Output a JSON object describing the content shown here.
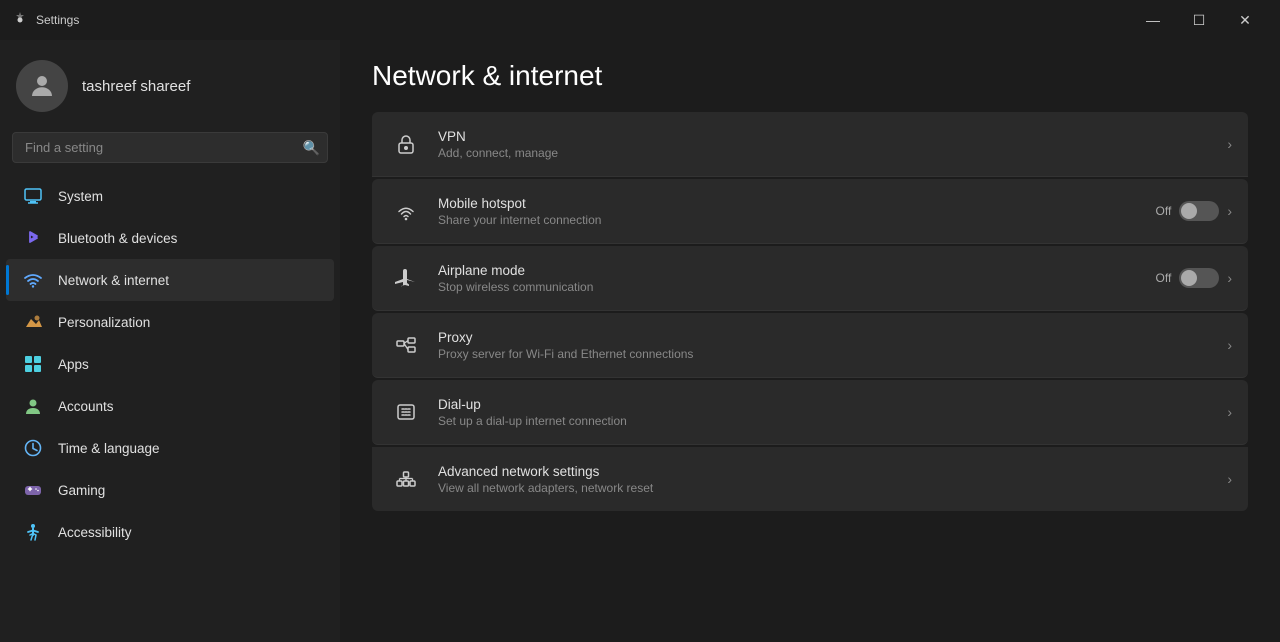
{
  "titlebar": {
    "title": "Settings",
    "controls": {
      "minimize": "—",
      "maximize": "☐",
      "close": "✕"
    }
  },
  "sidebar": {
    "profile": {
      "name": "tashreef shareef"
    },
    "search": {
      "placeholder": "Find a setting"
    },
    "nav": [
      {
        "id": "system",
        "label": "System",
        "icon": "🖥",
        "active": false
      },
      {
        "id": "bluetooth",
        "label": "Bluetooth & devices",
        "icon": "⬡",
        "active": false
      },
      {
        "id": "network",
        "label": "Network & internet",
        "icon": "🌐",
        "active": true
      },
      {
        "id": "personalization",
        "label": "Personalization",
        "icon": "✏",
        "active": false
      },
      {
        "id": "apps",
        "label": "Apps",
        "icon": "⊞",
        "active": false
      },
      {
        "id": "accounts",
        "label": "Accounts",
        "icon": "👤",
        "active": false
      },
      {
        "id": "time",
        "label": "Time & language",
        "icon": "🕐",
        "active": false
      },
      {
        "id": "gaming",
        "label": "Gaming",
        "icon": "🎮",
        "active": false
      },
      {
        "id": "accessibility",
        "label": "Accessibility",
        "icon": "♿",
        "active": false
      }
    ]
  },
  "content": {
    "page_title": "Network & internet",
    "items": [
      {
        "id": "vpn",
        "title": "VPN",
        "subtitle": "Add, connect, manage",
        "icon": "🔒",
        "has_toggle": false,
        "toggle_label": "",
        "has_chevron": true
      },
      {
        "id": "mobile-hotspot",
        "title": "Mobile hotspot",
        "subtitle": "Share your internet connection",
        "icon": "📶",
        "has_toggle": true,
        "toggle_label": "Off",
        "has_chevron": true
      },
      {
        "id": "airplane-mode",
        "title": "Airplane mode",
        "subtitle": "Stop wireless communication",
        "icon": "✈",
        "has_toggle": true,
        "toggle_label": "Off",
        "has_chevron": true
      },
      {
        "id": "proxy",
        "title": "Proxy",
        "subtitle": "Proxy server for Wi-Fi and Ethernet connections",
        "icon": "🖧",
        "has_toggle": false,
        "toggle_label": "",
        "has_chevron": true
      },
      {
        "id": "dialup",
        "title": "Dial-up",
        "subtitle": "Set up a dial-up internet connection",
        "icon": "📞",
        "has_toggle": false,
        "toggle_label": "",
        "has_chevron": true
      },
      {
        "id": "advanced-network",
        "title": "Advanced network settings",
        "subtitle": "View all network adapters, network reset",
        "icon": "🖧",
        "has_toggle": false,
        "toggle_label": "",
        "has_chevron": true
      }
    ]
  }
}
